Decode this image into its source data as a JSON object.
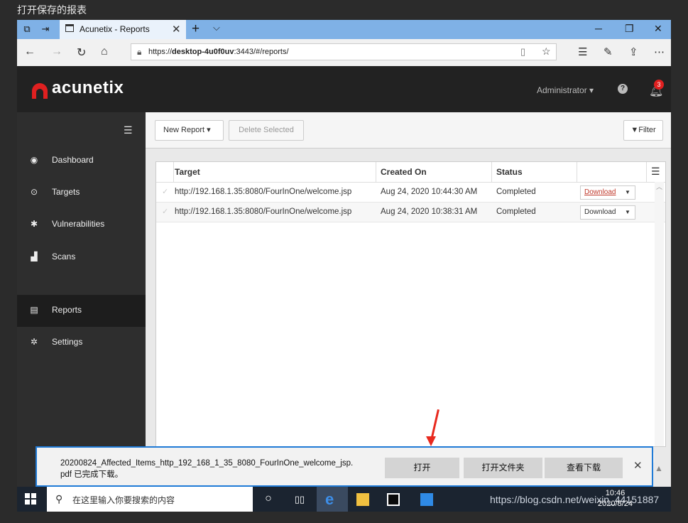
{
  "caption": "打开保存的报表",
  "browser": {
    "tab_title": "Acunetix - Reports",
    "url_prefix": "https://",
    "url_host": "desktop-4u0f0uv",
    "url_rest": ":3443/#/reports/"
  },
  "app": {
    "brand": "acunetix",
    "user": "Administrator",
    "notification_count": "3"
  },
  "sidebar": {
    "items": [
      {
        "label": "Dashboard",
        "icon": "dashboard-icon",
        "glyph": "◉"
      },
      {
        "label": "Targets",
        "icon": "target-icon",
        "glyph": "⊙"
      },
      {
        "label": "Vulnerabilities",
        "icon": "bug-icon",
        "glyph": "✱"
      },
      {
        "label": "Scans",
        "icon": "chart-icon",
        "glyph": "▟"
      },
      {
        "label": "Reports",
        "icon": "document-icon",
        "glyph": "▤"
      },
      {
        "label": "Settings",
        "icon": "gear-icon",
        "glyph": "✲"
      }
    ],
    "active": "Reports"
  },
  "toolbar": {
    "new_report": "New Report",
    "delete_selected": "Delete Selected",
    "filter": "Filter"
  },
  "table": {
    "columns": [
      "Target",
      "Created On",
      "Status"
    ],
    "rows": [
      {
        "target": "http://192.168.1.35:8080/FourInOne/welcome.jsp",
        "created": "Aug 24, 2020 10:44:30 AM",
        "status": "Completed",
        "action": "Download"
      },
      {
        "target": "http://192.168.1.35:8080/FourInOne/welcome.jsp",
        "created": "Aug 24, 2020 10:38:31 AM",
        "status": "Completed",
        "action": "Download"
      }
    ]
  },
  "download_bar": {
    "filename": "20200824_Affected_Items_http_192_168_1_35_8080_FourInOne_welcome_jsp.",
    "filename_line2": "pdf 已完成下载。",
    "open": "打开",
    "open_folder": "打开文件夹",
    "view_downloads": "查看下载"
  },
  "taskbar": {
    "search_placeholder": "在这里输入你要搜索的内容",
    "watermark": "https://blog.csdn.net/weixin_44151887",
    "time": "10:46",
    "date": "2020/8/24"
  },
  "colors": {
    "accent_red": "#e02020",
    "link_red": "#c0392b",
    "download_bar_border": "#1f7ad6"
  }
}
